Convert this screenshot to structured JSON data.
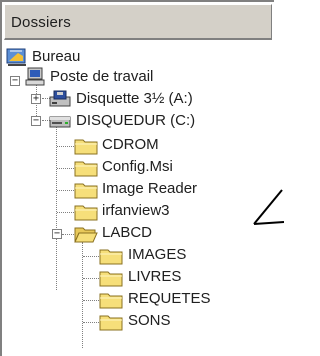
{
  "panel": {
    "header_label": "Dossiers"
  },
  "tree": {
    "bureau": "Bureau",
    "poste": "Poste de travail",
    "disquette": "Disquette 3½ (A:)",
    "disquedur": "DISQUEDUR (C:)",
    "cdrom": "CDROM",
    "config": "Config.Msi",
    "image_reader": "Image Reader",
    "irfanview": "irfanview3",
    "labcd": "LABCD",
    "images": "IMAGES",
    "livres": "LIVRES",
    "requetes": "REQUETES",
    "sons": "SONS"
  },
  "expanders": {
    "collapsed": "+",
    "expanded": "−"
  },
  "colors": {
    "folder_fill": "#f6df7a",
    "folder_stroke": "#8a7020",
    "header_bg": "#d4d0c8"
  }
}
